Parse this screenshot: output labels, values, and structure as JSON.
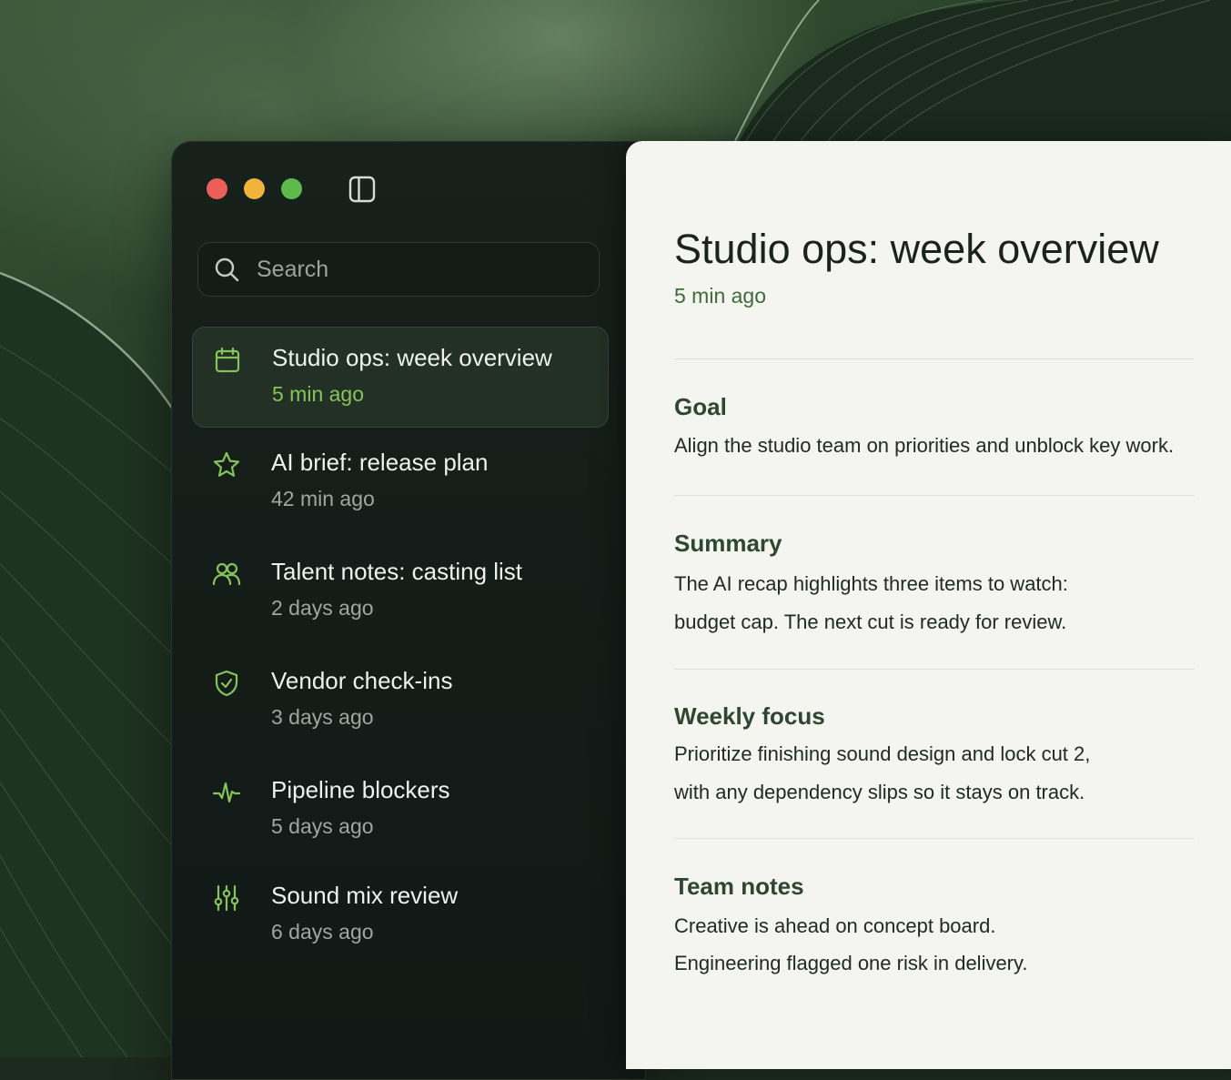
{
  "window": {
    "search_placeholder": "Search"
  },
  "sidebar": {
    "items": [
      {
        "title": "Studio ops: week overview",
        "time": "5 min ago",
        "icon": "calendar-icon",
        "active": true
      },
      {
        "title": "AI brief: release plan",
        "time": "42 min ago",
        "icon": "star-icon"
      },
      {
        "title": "Talent notes: casting list",
        "time": "2 days ago",
        "icon": "users-icon"
      },
      {
        "title": "Vendor check-ins",
        "time": "3 days ago",
        "icon": "shield-check-icon"
      },
      {
        "title": "Pipeline blockers",
        "time": "5 days ago",
        "icon": "activity-icon"
      },
      {
        "title": "Sound mix review",
        "time": "6 days ago",
        "icon": "sliders-icon"
      }
    ]
  },
  "detail": {
    "title": "Studio ops: week overview",
    "time": "5 min ago",
    "sections": [
      {
        "title": "Goal",
        "lines": [
          "Align the studio team on priorities and unblock key work."
        ]
      },
      {
        "title": "Summary",
        "lines": [
          "The AI recap highlights three items to watch:",
          "budget cap. The next cut is ready for review."
        ]
      },
      {
        "title": "Weekly focus",
        "lines": [
          "Prioritize finishing sound design and lock cut 2,",
          "with any dependency slips so it stays on track."
        ]
      },
      {
        "title": "Team notes",
        "lines": [
          "Creative is ahead on concept board.",
          "Engineering flagged one risk in delivery."
        ]
      }
    ]
  },
  "colors": {
    "accent_green": "#86c35a",
    "sidebar_bg": "#141c18",
    "pane_bg": "#f4f4f1",
    "section_title": "#2f4630"
  }
}
